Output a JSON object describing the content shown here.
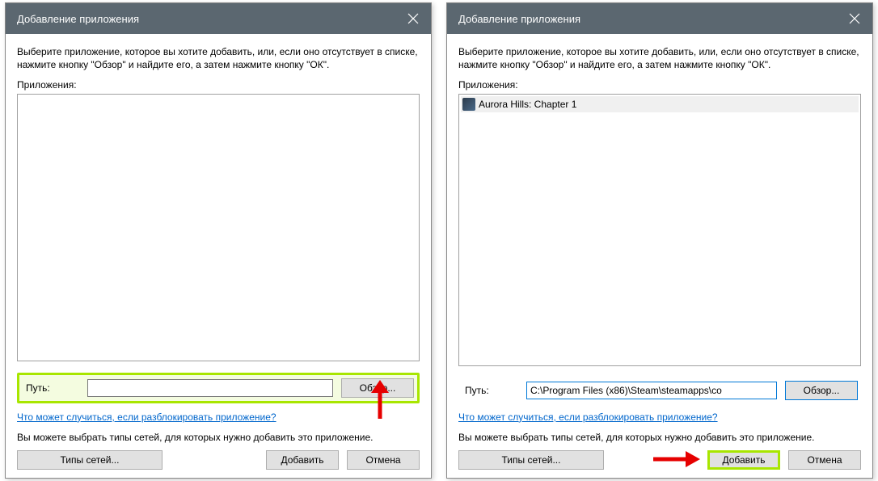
{
  "dialogs": {
    "left": {
      "title": "Добавление приложения",
      "intro": "Выберите приложение, которое вы хотите добавить, или, если оно отсутствует в списке, нажмите кнопку \"Обзор\" и найдите его, а затем нажмите кнопку \"ОК\".",
      "apps_label": "Приложения:",
      "path_label": "Путь:",
      "path_value": "",
      "browse": "Обзор...",
      "link": "Что может случиться, если разблокировать приложение?",
      "netinfo": "Вы можете выбрать типы сетей, для которых нужно добавить это приложение.",
      "net_types": "Типы сетей...",
      "add": "Добавить",
      "cancel": "Отмена"
    },
    "right": {
      "title": "Добавление приложения",
      "intro": "Выберите приложение, которое вы хотите добавить, или, если оно отсутствует в списке, нажмите кнопку \"Обзор\" и найдите его, а затем нажмите кнопку \"ОК\".",
      "apps_label": "Приложения:",
      "list_item": "Aurora Hills: Chapter 1",
      "path_label": "Путь:",
      "path_value": "C:\\Program Files (x86)\\Steam\\steamapps\\co",
      "browse": "Обзор...",
      "link": "Что может случиться, если разблокировать приложение?",
      "netinfo": "Вы можете выбрать типы сетей, для которых нужно добавить это приложение.",
      "net_types": "Типы сетей...",
      "add": "Добавить",
      "cancel": "Отмена"
    }
  }
}
